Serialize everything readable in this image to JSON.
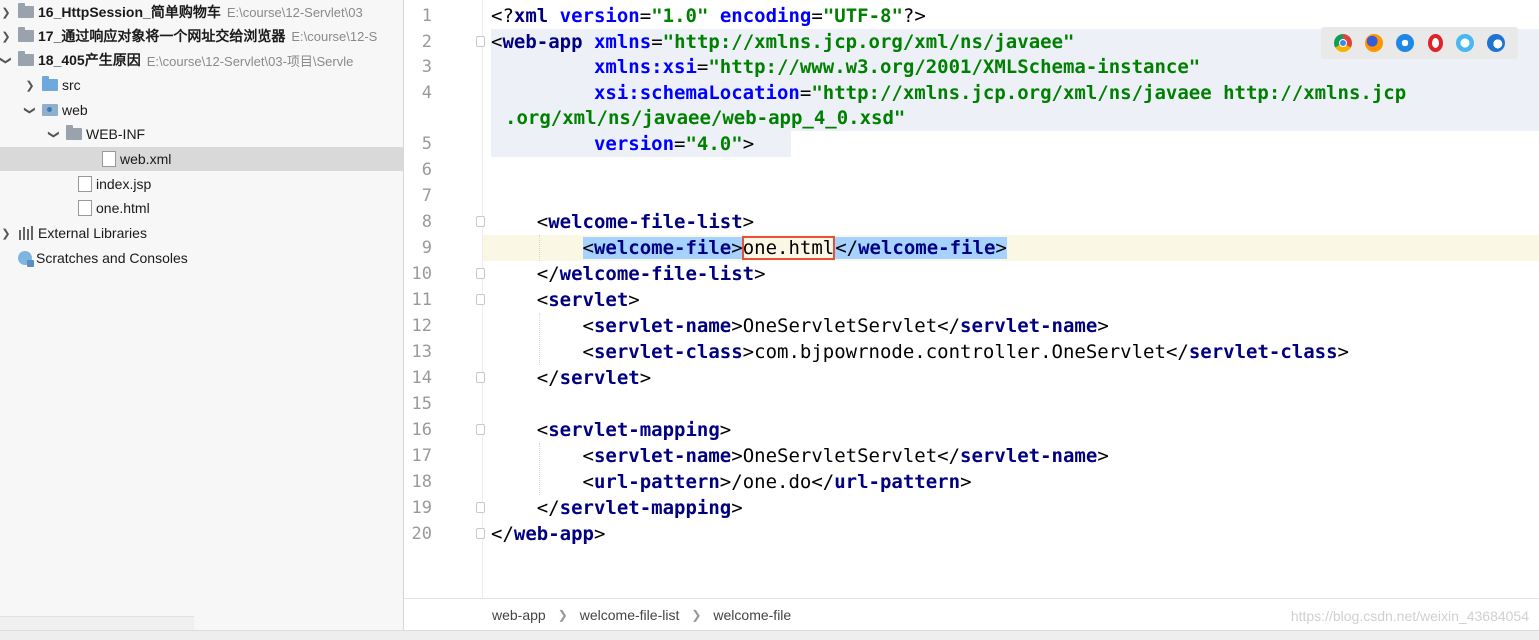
{
  "project_tree": {
    "items": [
      {
        "name": "16_HttpSession_简单购物车",
        "path": "E:\\course\\12-Servlet\\03"
      },
      {
        "name": "17_通过响应对象将一个网址交给浏览器",
        "path": "E:\\course\\12-S"
      },
      {
        "name": "18_405产生原因",
        "path": "E:\\course\\12-Servlet\\03-项目\\Servle"
      },
      {
        "name": "src"
      },
      {
        "name": "web"
      },
      {
        "name": "WEB-INF"
      },
      {
        "name": "web.xml"
      },
      {
        "name": "index.jsp"
      },
      {
        "name": "one.html"
      },
      {
        "name": "External Libraries"
      },
      {
        "name": "Scratches and Consoles"
      }
    ]
  },
  "editor": {
    "line_numbers": [
      "1",
      "2",
      "3",
      "4",
      "",
      "5",
      "6",
      "7",
      "8",
      "9",
      "10",
      "11",
      "12",
      "13",
      "14",
      "15",
      "16",
      "17",
      "18",
      "19",
      "20"
    ],
    "code": {
      "xml_decl_start": "<?",
      "xml_decl_name": "xml",
      "xml_decl_end": "?>",
      "attr_version": "version",
      "attr_encoding": "encoding",
      "val_version": "\"1.0\"",
      "val_encoding": "\"UTF-8\"",
      "web_app": "web-app",
      "attr_xmlns": "xmlns",
      "val_xmlns": "\"http://xmlns.jcp.org/xml/ns/javaee\"",
      "attr_xmlns_xsi": "xmlns:xsi",
      "val_xmlns_xsi": "\"http://www.w3.org/2001/XMLSchema-instance\"",
      "attr_schema": "xsi:schemaLocation",
      "val_schema_1": "\"http://xmlns.jcp.org/xml/ns/javaee http://xmlns.jcp",
      "val_schema_2": ".org/xml/ns/javaee/web-app_4_0.xsd\"",
      "attr_app_version": "version",
      "val_app_version": "\"4.0\"",
      "welcome_file_list": "welcome-file-list",
      "welcome_file": "welcome-file",
      "welcome_file_value": "one.html",
      "servlet": "servlet",
      "servlet_name": "servlet-name",
      "servlet_name_value": "OneServletServlet",
      "servlet_class": "servlet-class",
      "servlet_class_value": "com.bjpowrnode.controller.OneServlet",
      "servlet_mapping": "servlet-mapping",
      "url_pattern": "url-pattern",
      "url_pattern_value": "/one.do"
    },
    "browser_icons": [
      "chrome-icon",
      "firefox-icon",
      "safari-icon",
      "opera-icon",
      "ie-icon",
      "edge-icon"
    ]
  },
  "breadcrumb": [
    "web-app",
    "welcome-file-list",
    "welcome-file"
  ],
  "watermark": "https://blog.csdn.net/weixin_43684054"
}
